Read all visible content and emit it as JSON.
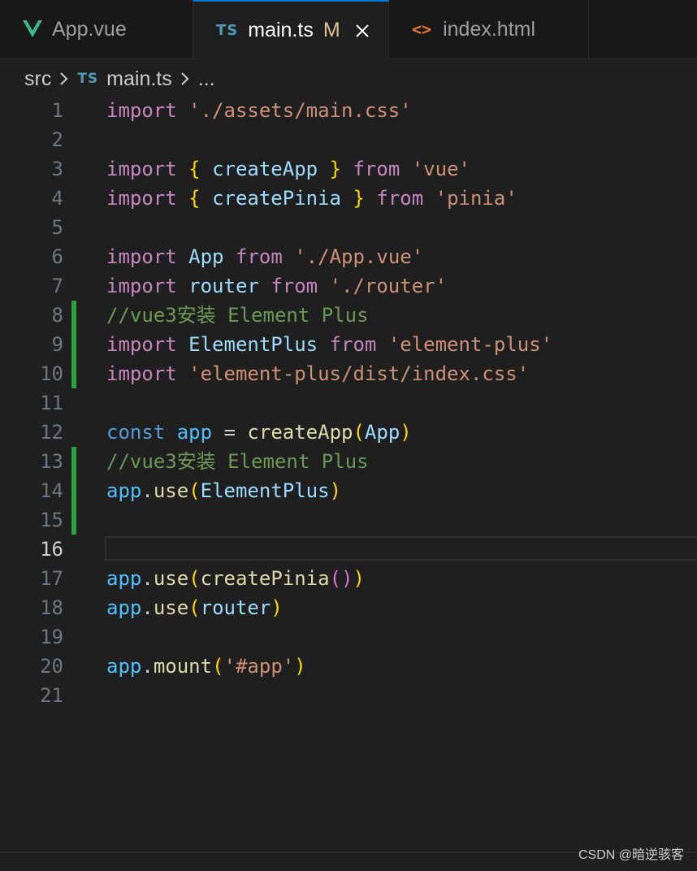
{
  "tabs": [
    {
      "label": "App.vue",
      "icon": "vue-icon",
      "active": false
    },
    {
      "label": "main.ts",
      "icon": "ts-icon",
      "active": true,
      "modified": "M"
    },
    {
      "label": "index.html",
      "icon": "html-icon",
      "active": false
    }
  ],
  "icons": {
    "ts": "TS",
    "html": "<>"
  },
  "breadcrumb": {
    "folder": "src",
    "file": "main.ts",
    "more": "..."
  },
  "current_line": 16,
  "lines": [
    {
      "n": "1",
      "tokens": [
        [
          "kw",
          "import"
        ],
        [
          "p",
          " "
        ],
        [
          "str",
          "'./assets/main.css'"
        ]
      ]
    },
    {
      "n": "2",
      "tokens": []
    },
    {
      "n": "3",
      "tokens": [
        [
          "kw",
          "import"
        ],
        [
          "p",
          " "
        ],
        [
          "br",
          "{"
        ],
        [
          "p",
          " "
        ],
        [
          "var",
          "createApp"
        ],
        [
          "p",
          " "
        ],
        [
          "br",
          "}"
        ],
        [
          "p",
          " "
        ],
        [
          "kw",
          "from"
        ],
        [
          "p",
          " "
        ],
        [
          "str",
          "'vue'"
        ]
      ]
    },
    {
      "n": "4",
      "tokens": [
        [
          "kw",
          "import"
        ],
        [
          "p",
          " "
        ],
        [
          "br",
          "{"
        ],
        [
          "p",
          " "
        ],
        [
          "var",
          "createPinia"
        ],
        [
          "p",
          " "
        ],
        [
          "br",
          "}"
        ],
        [
          "p",
          " "
        ],
        [
          "kw",
          "from"
        ],
        [
          "p",
          " "
        ],
        [
          "str",
          "'pinia'"
        ]
      ]
    },
    {
      "n": "5",
      "tokens": []
    },
    {
      "n": "6",
      "tokens": [
        [
          "kw",
          "import"
        ],
        [
          "p",
          " "
        ],
        [
          "var",
          "App"
        ],
        [
          "p",
          " "
        ],
        [
          "kw",
          "from"
        ],
        [
          "p",
          " "
        ],
        [
          "str",
          "'./App.vue'"
        ]
      ]
    },
    {
      "n": "7",
      "tokens": [
        [
          "kw",
          "import"
        ],
        [
          "p",
          " "
        ],
        [
          "var",
          "router"
        ],
        [
          "p",
          " "
        ],
        [
          "kw",
          "from"
        ],
        [
          "p",
          " "
        ],
        [
          "str",
          "'./router'"
        ]
      ]
    },
    {
      "n": "8",
      "tokens": [
        [
          "cmt",
          "//vue3安装 Element Plus"
        ]
      ],
      "changed": true
    },
    {
      "n": "9",
      "tokens": [
        [
          "kw",
          "import"
        ],
        [
          "p",
          " "
        ],
        [
          "var",
          "ElementPlus"
        ],
        [
          "p",
          " "
        ],
        [
          "kw",
          "from"
        ],
        [
          "p",
          " "
        ],
        [
          "str",
          "'element-plus'"
        ]
      ],
      "changed": true
    },
    {
      "n": "10",
      "tokens": [
        [
          "kw",
          "import"
        ],
        [
          "p",
          " "
        ],
        [
          "str",
          "'element-plus/dist/index.css'"
        ]
      ],
      "changed": true
    },
    {
      "n": "11",
      "tokens": []
    },
    {
      "n": "12",
      "tokens": [
        [
          "decl",
          "const"
        ],
        [
          "p",
          " "
        ],
        [
          "const",
          "app"
        ],
        [
          "p",
          " = "
        ],
        [
          "fn",
          "createApp"
        ],
        [
          "br",
          "("
        ],
        [
          "var",
          "App"
        ],
        [
          "br",
          ")"
        ]
      ]
    },
    {
      "n": "13",
      "tokens": [
        [
          "cmt",
          "//vue3安装 Element Plus"
        ]
      ],
      "changed": true
    },
    {
      "n": "14",
      "tokens": [
        [
          "const",
          "app"
        ],
        [
          "p",
          "."
        ],
        [
          "fn",
          "use"
        ],
        [
          "br",
          "("
        ],
        [
          "var",
          "ElementPlus"
        ],
        [
          "br",
          ")"
        ]
      ],
      "changed": true
    },
    {
      "n": "15",
      "tokens": [],
      "changed": true
    },
    {
      "n": "16",
      "tokens": []
    },
    {
      "n": "17",
      "tokens": [
        [
          "const",
          "app"
        ],
        [
          "p",
          "."
        ],
        [
          "fn",
          "use"
        ],
        [
          "br",
          "("
        ],
        [
          "fn",
          "createPinia"
        ],
        [
          "br2",
          "()"
        ],
        [
          "br",
          ")"
        ]
      ]
    },
    {
      "n": "18",
      "tokens": [
        [
          "const",
          "app"
        ],
        [
          "p",
          "."
        ],
        [
          "fn",
          "use"
        ],
        [
          "br",
          "("
        ],
        [
          "var",
          "router"
        ],
        [
          "br",
          ")"
        ]
      ]
    },
    {
      "n": "19",
      "tokens": []
    },
    {
      "n": "20",
      "tokens": [
        [
          "const",
          "app"
        ],
        [
          "p",
          "."
        ],
        [
          "fn",
          "mount"
        ],
        [
          "br",
          "("
        ],
        [
          "str",
          "'#app'"
        ],
        [
          "br",
          ")"
        ]
      ]
    },
    {
      "n": "21",
      "tokens": []
    }
  ],
  "watermark": "CSDN @暗逆骇客",
  "colors": {
    "background": "#1f1f1f",
    "tabbar": "#181818",
    "gutter_change": "#2ea043",
    "keyword": "#c586c0",
    "string": "#ce9178",
    "comment": "#6a9955"
  }
}
